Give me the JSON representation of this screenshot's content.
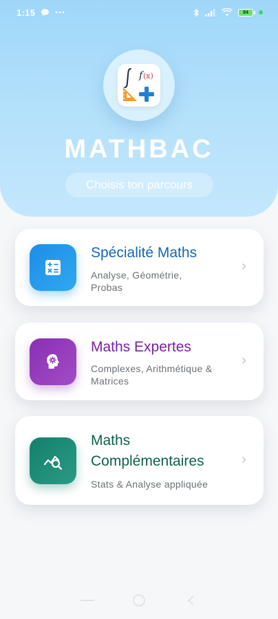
{
  "status_bar": {
    "time": "1:15",
    "battery_level": "84",
    "colors": {
      "text": "#ffffff",
      "battery_fill": "#6de06d",
      "dot": "#3bd46b"
    },
    "icons": [
      "chat-bubble-icon",
      "more-dots-icon",
      "bluetooth-icon",
      "signal-icon",
      "wifi-icon",
      "battery-icon"
    ]
  },
  "header": {
    "app_title": "MATHBAC",
    "subtitle": "Choisis ton parcours",
    "logo_icon": "math-symbols-logo",
    "colors": {
      "gradient_top": "#9fd7f9",
      "gradient_bottom": "#c3e7fd"
    }
  },
  "tracks": [
    {
      "title": "Spécialité Maths",
      "description": "Analyse, Géométrie, Probas",
      "icon": "calculator-icon",
      "color": "#1466b8"
    },
    {
      "title": "Maths Expertes",
      "description": "Complexes, Arithmétique & Matrices",
      "icon": "head-gear-icon",
      "color": "#7b1fa2"
    },
    {
      "title": "Maths Complémentaires",
      "description": "Stats & Analyse appliquée",
      "icon": "chart-search-icon",
      "color": "#0e5f4b"
    }
  ],
  "nav_bar": {
    "icons": [
      "menu-icon",
      "home-icon",
      "back-icon"
    ]
  }
}
